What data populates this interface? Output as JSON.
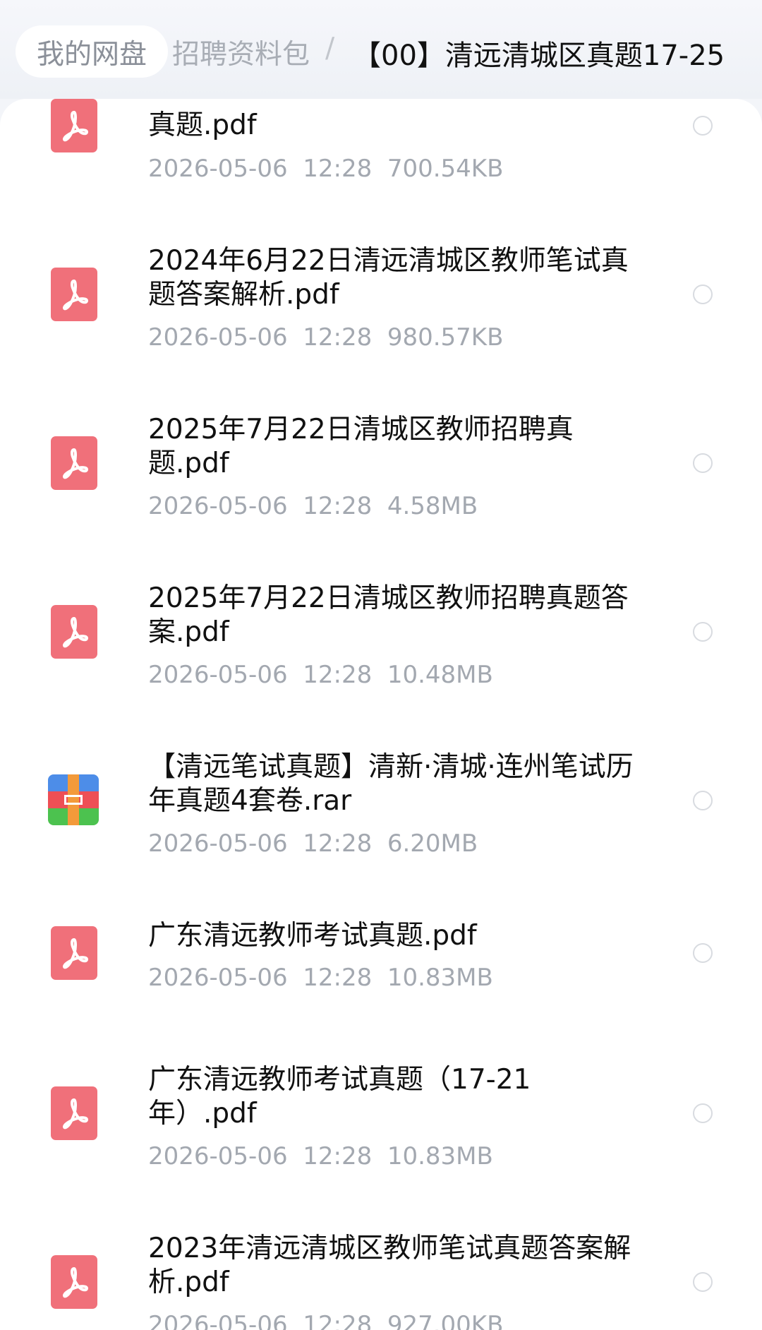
{
  "breadcrumb": {
    "root": "我的网盘",
    "parent": "招聘资料包",
    "separator": "/",
    "current": "【00】清远清城区真题17-25"
  },
  "icons": {
    "pdf": "pdf-file-icon",
    "rar": "archive-file-icon",
    "select": "radio-circle-icon"
  },
  "colors": {
    "pdf_icon": "#f0707a",
    "meta_text": "#a3a8b0",
    "rar_top": "#4d8de8",
    "rar_mid": "#ee4f55",
    "rar_bottom": "#4cc24f",
    "rar_strap": "#f39a3a"
  },
  "files": [
    {
      "name": "真题.pdf",
      "date": "2026-05-06",
      "time": "12:28",
      "size": "700.54KB",
      "type": "pdf"
    },
    {
      "name": "2024年6月22日清远清城区教师笔试真题答案解析.pdf",
      "date": "2026-05-06",
      "time": "12:28",
      "size": "980.57KB",
      "type": "pdf"
    },
    {
      "name": "2025年7月22日清城区教师招聘真题.pdf",
      "date": "2026-05-06",
      "time": "12:28",
      "size": "4.58MB",
      "type": "pdf"
    },
    {
      "name": "2025年7月22日清城区教师招聘真题答案.pdf",
      "date": "2026-05-06",
      "time": "12:28",
      "size": "10.48MB",
      "type": "pdf"
    },
    {
      "name": "【清远笔试真题】清新·清城·连州笔试历年真题4套卷.rar",
      "date": "2026-05-06",
      "time": "12:28",
      "size": "6.20MB",
      "type": "rar"
    },
    {
      "name": "广东清远教师考试真题.pdf",
      "date": "2026-05-06",
      "time": "12:28",
      "size": "10.83MB",
      "type": "pdf"
    },
    {
      "name": "广东清远教师考试真题（17-21年）.pdf",
      "date": "2026-05-06",
      "time": "12:28",
      "size": "10.83MB",
      "type": "pdf"
    },
    {
      "name": "2023年清远清城区教师笔试真题答案解析.pdf",
      "date": "2026-05-06",
      "time": "12:28",
      "size": "927.00KB",
      "type": "pdf"
    }
  ]
}
